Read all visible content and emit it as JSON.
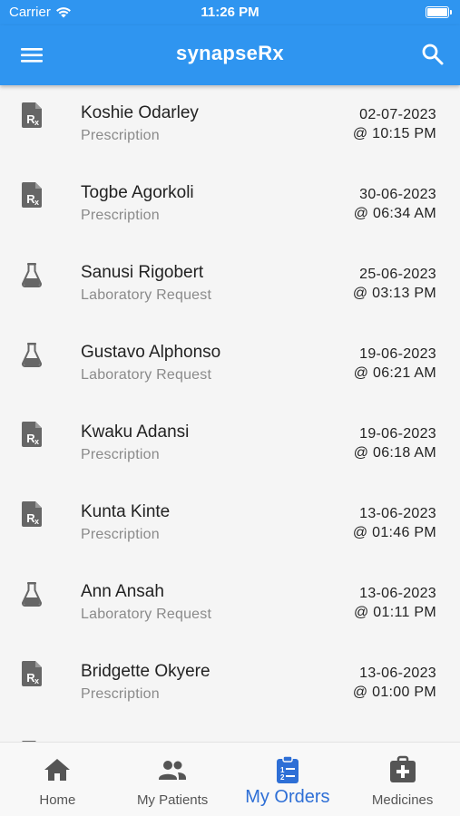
{
  "status": {
    "carrier": "Carrier",
    "time": "11:26 PM"
  },
  "appbar": {
    "title": "synapseRx"
  },
  "orders": [
    {
      "name": "Koshie Odarley",
      "type": "Prescription",
      "date": "02-07-2023",
      "time": "@ 10:15 PM",
      "icon": "prescription-icon"
    },
    {
      "name": "Togbe Agorkoli",
      "type": "Prescription",
      "date": "30-06-2023",
      "time": "@ 06:34 AM",
      "icon": "prescription-icon"
    },
    {
      "name": "Sanusi Rigobert",
      "type": "Laboratory Request",
      "date": "25-06-2023",
      "time": "@ 03:13 PM",
      "icon": "flask-icon"
    },
    {
      "name": "Gustavo Alphonso",
      "type": "Laboratory Request",
      "date": "19-06-2023",
      "time": "@ 06:21 AM",
      "icon": "flask-icon"
    },
    {
      "name": "Kwaku Adansi",
      "type": "Prescription",
      "date": "19-06-2023",
      "time": "@ 06:18 AM",
      "icon": "prescription-icon"
    },
    {
      "name": "Kunta Kinte",
      "type": "Prescription",
      "date": "13-06-2023",
      "time": "@ 01:46 PM",
      "icon": "prescription-icon"
    },
    {
      "name": "Ann Ansah",
      "type": "Laboratory Request",
      "date": "13-06-2023",
      "time": "@ 01:11 PM",
      "icon": "flask-icon"
    },
    {
      "name": "Bridgette Okyere",
      "type": "Prescription",
      "date": "13-06-2023",
      "time": "@ 01:00 PM",
      "icon": "prescription-icon"
    }
  ],
  "nav": [
    {
      "label": "Home",
      "icon": "home-icon",
      "active": false
    },
    {
      "label": "My Patients",
      "icon": "patients-icon",
      "active": false
    },
    {
      "label": "My Orders",
      "icon": "orders-icon",
      "active": true
    },
    {
      "label": "Medicines",
      "icon": "medkit-icon",
      "active": false
    }
  ],
  "colors": {
    "primary": "#2f95f0",
    "active_nav": "#2e6fd6",
    "icon_gray": "#666666"
  }
}
